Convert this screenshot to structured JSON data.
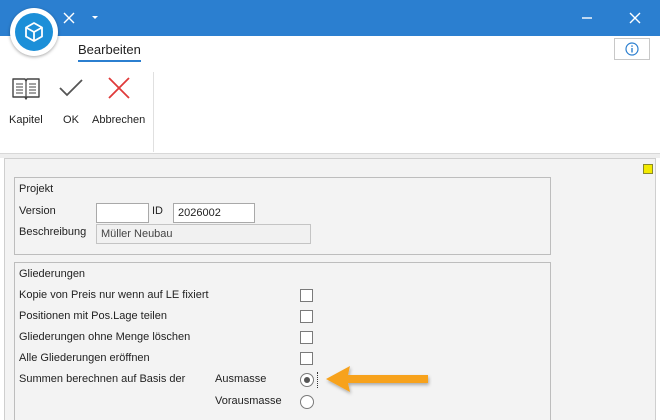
{
  "titlebar": {
    "bg_color": "#2b7fd0",
    "close_icon": "close-icon",
    "minimize_icon": "minimize-icon"
  },
  "ribbon": {
    "active_tab": "Bearbeiten",
    "buttons": {
      "kapitel": "Kapitel",
      "ok": "OK",
      "abbrechen": "Abbrechen"
    }
  },
  "projekt": {
    "title": "Projekt",
    "version_label": "Version",
    "version_value": "",
    "id_label": "ID",
    "id_value": "2026002",
    "beschreibung_label": "Beschreibung",
    "beschreibung_value": "Müller Neubau"
  },
  "gliederungen": {
    "title": "Gliederungen",
    "options": [
      {
        "label": "Kopie von Preis nur wenn auf LE fixiert",
        "checked": false
      },
      {
        "label": "Positionen mit Pos.Lage teilen",
        "checked": false
      },
      {
        "label": "Gliederungen ohne Menge löschen",
        "checked": false
      },
      {
        "label": "Alle Gliederungen eröffnen",
        "checked": false
      }
    ],
    "summen_label": "Summen berechnen auf Basis der",
    "radio_options": [
      {
        "label": "Ausmasse",
        "selected": true
      },
      {
        "label": "Vorausmasse",
        "selected": false
      }
    ]
  },
  "colors": {
    "accent": "#2b7fd0",
    "arrow": "#f7a21b",
    "indicator": "#f3ea00"
  }
}
